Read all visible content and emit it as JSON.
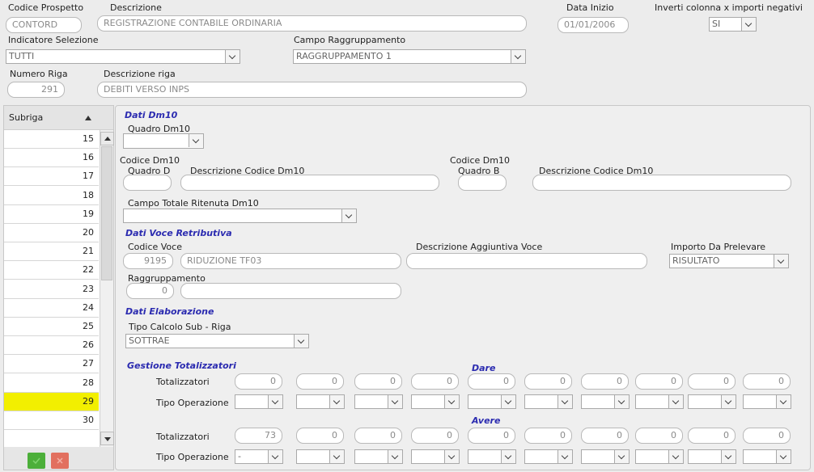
{
  "header": {
    "codice_prospetto_label": "Codice Prospetto",
    "codice_prospetto_value": "CONTORD",
    "descrizione_label": "Descrizione",
    "descrizione_value": "REGISTRAZIONE CONTABILE ORDINARIA",
    "data_inizio_label": "Data Inizio",
    "data_inizio_value": "01/01/2006",
    "inverti_label": "Inverti colonna x importi negativi",
    "inverti_value": "SI",
    "indicatore_label": "Indicatore Selezione",
    "indicatore_value": "TUTTI",
    "campo_ragg_label": "Campo Raggruppamento",
    "campo_ragg_value": "RAGGRUPPAMENTO 1",
    "numero_riga_label": "Numero Riga",
    "numero_riga_value": "291",
    "descrizione_riga_label": "Descrizione riga",
    "descrizione_riga_value": "DEBITI VERSO INPS"
  },
  "subriga": {
    "header": "Subriga",
    "rows": [
      "15",
      "16",
      "17",
      "18",
      "19",
      "20",
      "21",
      "22",
      "23",
      "24",
      "25",
      "26",
      "27",
      "28",
      "29",
      "30"
    ],
    "selected": "29"
  },
  "dm10": {
    "title": "Dati Dm10",
    "quadro_label": "Quadro Dm10",
    "quadro_value": "",
    "codice_d_label1": "Codice Dm10",
    "codice_d_label2": "Quadro D",
    "descr_d_label": "Descrizione Codice Dm10",
    "codice_b_label1": "Codice Dm10",
    "codice_b_label2": "Quadro B",
    "descr_b_label": "Descrizione Codice Dm10",
    "campo_totale_label": "Campo Totale Ritenuta Dm10",
    "campo_totale_value": ""
  },
  "voce": {
    "title": "Dati Voce Retributiva",
    "codice_label": "Codice Voce",
    "codice_value": "9195",
    "codice_descr": "RIDUZIONE TF03",
    "descr_agg_label": "Descrizione Aggiuntiva Voce",
    "importo_label": "Importo Da Prelevare",
    "importo_value": "RISULTATO",
    "ragg_label": "Raggruppamento",
    "ragg_value": "0"
  },
  "elab": {
    "title": "Dati Elaborazione",
    "tipo_label": "Tipo Calcolo Sub - Riga",
    "tipo_value": "SOTTRAE"
  },
  "totalizzatori": {
    "title": "Gestione Totalizzatori",
    "dare_label": "Dare",
    "avere_label": "Avere",
    "tot_label": "Totalizzatori",
    "op_label": "Tipo Operazione",
    "dare_values": [
      "0",
      "0",
      "0",
      "0",
      "0",
      "0",
      "0",
      "0",
      "0",
      "0"
    ],
    "dare_ops": [
      "",
      "",
      "",
      "",
      "",
      "",
      "",
      "",
      "",
      ""
    ],
    "avere_values": [
      "73",
      "0",
      "0",
      "0",
      "0",
      "0",
      "0",
      "0",
      "0",
      "0"
    ],
    "avere_ops": [
      "-",
      "",
      "",
      "",
      "",
      "",
      "",
      "",
      "",
      ""
    ]
  },
  "colors": {
    "selected_row": "#f2ef00",
    "section_title": "#2b2bb0",
    "confirm": "#4caf3a",
    "cancel": "#e2705f"
  }
}
